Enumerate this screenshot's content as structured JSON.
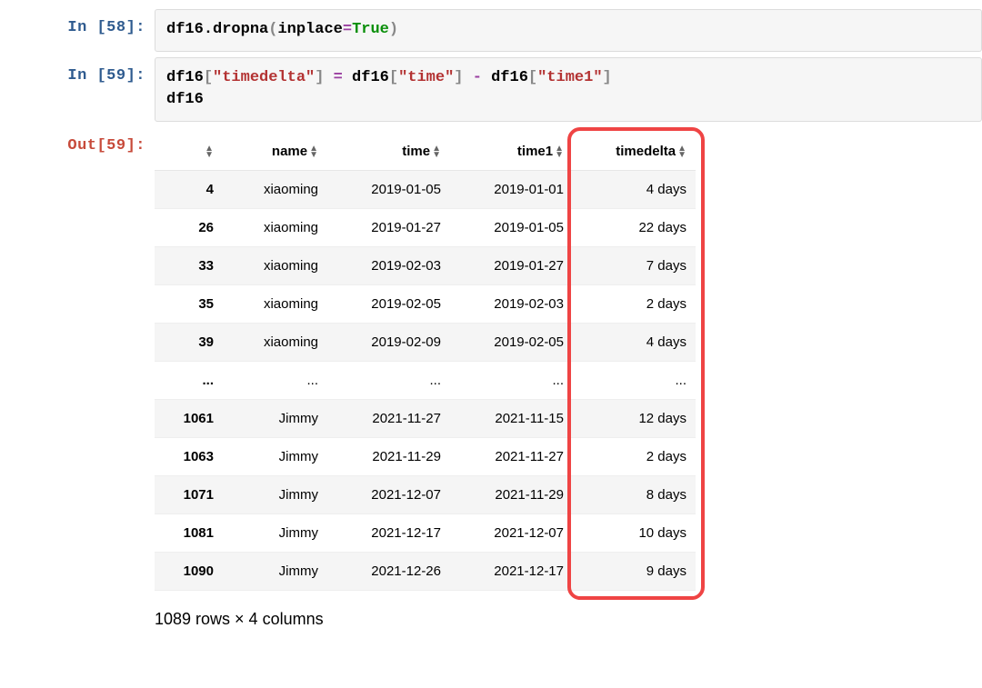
{
  "cells": {
    "in58_prompt": "In [58]:",
    "in59_prompt": "In [59]:",
    "out59_prompt": "Out[59]:",
    "in58_code": {
      "p0": "df16",
      "dot": ".dropna",
      "op_inplace": "inplace",
      "eq": "=",
      "kw_true": "True",
      "open": "(",
      "close": ")"
    },
    "in59_code": {
      "line1": {
        "p0": "df16",
        "b0": "[",
        "s0": "\"timedelta\"",
        "b1": "]",
        "sp0": " ",
        "eq": "=",
        "sp1": " ",
        "p1": "df16",
        "b2": "[",
        "s1": "\"time\"",
        "b3": "]",
        "sp2": " ",
        "minus": "-",
        "sp3": " ",
        "p2": "df16",
        "b4": "[",
        "s2": "\"time1\"",
        "b5": "]"
      },
      "line2": "df16"
    }
  },
  "table": {
    "columns": [
      "",
      "name",
      "time",
      "time1",
      "timedelta"
    ],
    "rows": [
      {
        "idx": "4",
        "name": "xiaoming",
        "time": "2019-01-05",
        "time1": "2019-01-01",
        "timedelta": "4 days"
      },
      {
        "idx": "26",
        "name": "xiaoming",
        "time": "2019-01-27",
        "time1": "2019-01-05",
        "timedelta": "22 days"
      },
      {
        "idx": "33",
        "name": "xiaoming",
        "time": "2019-02-03",
        "time1": "2019-01-27",
        "timedelta": "7 days"
      },
      {
        "idx": "35",
        "name": "xiaoming",
        "time": "2019-02-05",
        "time1": "2019-02-03",
        "timedelta": "2 days"
      },
      {
        "idx": "39",
        "name": "xiaoming",
        "time": "2019-02-09",
        "time1": "2019-02-05",
        "timedelta": "4 days"
      },
      {
        "idx": "...",
        "name": "...",
        "time": "...",
        "time1": "...",
        "timedelta": "..."
      },
      {
        "idx": "1061",
        "name": "Jimmy",
        "time": "2021-11-27",
        "time1": "2021-11-15",
        "timedelta": "12 days"
      },
      {
        "idx": "1063",
        "name": "Jimmy",
        "time": "2021-11-29",
        "time1": "2021-11-27",
        "timedelta": "2 days"
      },
      {
        "idx": "1071",
        "name": "Jimmy",
        "time": "2021-12-07",
        "time1": "2021-11-29",
        "timedelta": "8 days"
      },
      {
        "idx": "1081",
        "name": "Jimmy",
        "time": "2021-12-17",
        "time1": "2021-12-07",
        "timedelta": "10 days"
      },
      {
        "idx": "1090",
        "name": "Jimmy",
        "time": "2021-12-26",
        "time1": "2021-12-17",
        "timedelta": "9 days"
      }
    ],
    "summary": "1089 rows × 4 columns",
    "highlight_column": "timedelta"
  }
}
